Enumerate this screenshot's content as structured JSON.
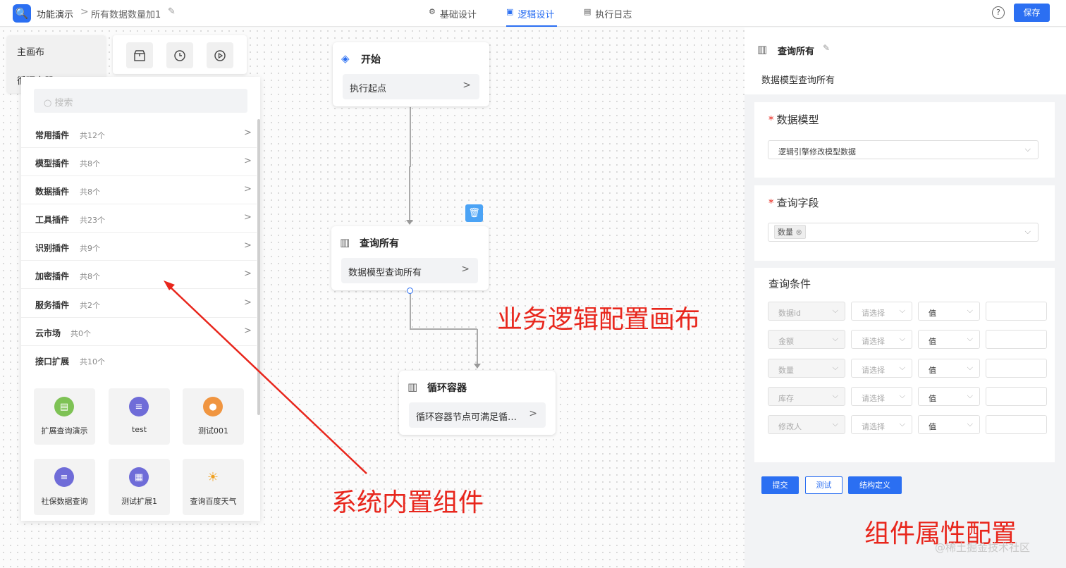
{
  "topbar": {
    "app_title": "功能演示",
    "breadcrumb_sep": ">",
    "page_title": "所有数据数量加1",
    "tabs": [
      {
        "label": "基础设计",
        "icon": "gear-icon",
        "active": false
      },
      {
        "label": "逻辑设计",
        "icon": "logic-icon",
        "active": true
      },
      {
        "label": "执行日志",
        "icon": "document-icon",
        "active": false
      }
    ],
    "help": "?",
    "save_label": "保存"
  },
  "nav": {
    "items": [
      "主画布",
      "循环容器"
    ]
  },
  "plugins": {
    "search_placeholder": "搜索",
    "categories": [
      {
        "name": "常用插件",
        "count": "共12个"
      },
      {
        "name": "模型插件",
        "count": "共8个"
      },
      {
        "name": "数据插件",
        "count": "共8个"
      },
      {
        "name": "工具插件",
        "count": "共23个"
      },
      {
        "name": "识别插件",
        "count": "共9个"
      },
      {
        "name": "加密插件",
        "count": "共8个"
      },
      {
        "name": "服务插件",
        "count": "共2个"
      },
      {
        "name": "云市场",
        "count": "共0个"
      },
      {
        "name": "接口扩展",
        "count": "共10个"
      }
    ],
    "tiles": [
      {
        "label": "扩展查询演示",
        "color": "#7ec255"
      },
      {
        "label": "test",
        "color": "#6f6cd8"
      },
      {
        "label": "测试001",
        "color": "#f09540"
      },
      {
        "label": "社保数据查询",
        "color": "#6f6cd8"
      },
      {
        "label": "测试扩展1",
        "color": "#6f6cd8"
      },
      {
        "label": "查询百度天气",
        "color": "#f0a020"
      }
    ]
  },
  "nodes": {
    "start": {
      "title": "开始",
      "body": "执行起点"
    },
    "query": {
      "title": "查询所有",
      "body": "数据模型查询所有"
    },
    "loop": {
      "title": "循环容器",
      "body": "循环容器节点可满足循…"
    }
  },
  "annotations": {
    "canvas": "业务逻辑配置画布",
    "builtin": "系统内置组件",
    "props": "组件属性配置"
  },
  "props": {
    "title": "查询所有",
    "subtitle": "数据模型查询所有",
    "data_model": {
      "label": "数据模型",
      "value": "逻辑引擎修改模型数据"
    },
    "query_field": {
      "label": "查询字段",
      "tag": "数量"
    },
    "conditions": {
      "label": "查询条件",
      "rows": [
        {
          "field": "数据id",
          "op": "请选择",
          "type": "值"
        },
        {
          "field": "金额",
          "op": "请选择",
          "type": "值"
        },
        {
          "field": "数量",
          "op": "请选择",
          "type": "值"
        },
        {
          "field": "库存",
          "op": "请选择",
          "type": "值"
        },
        {
          "field": "修改人",
          "op": "请选择",
          "type": "值"
        }
      ]
    },
    "buttons": {
      "submit": "提交",
      "test": "测试",
      "struct": "结构定义"
    }
  },
  "watermark": "@稀土掘金技术社区",
  "colors": {
    "primary": "#2b6ff2",
    "annotation": "#e8261c"
  }
}
